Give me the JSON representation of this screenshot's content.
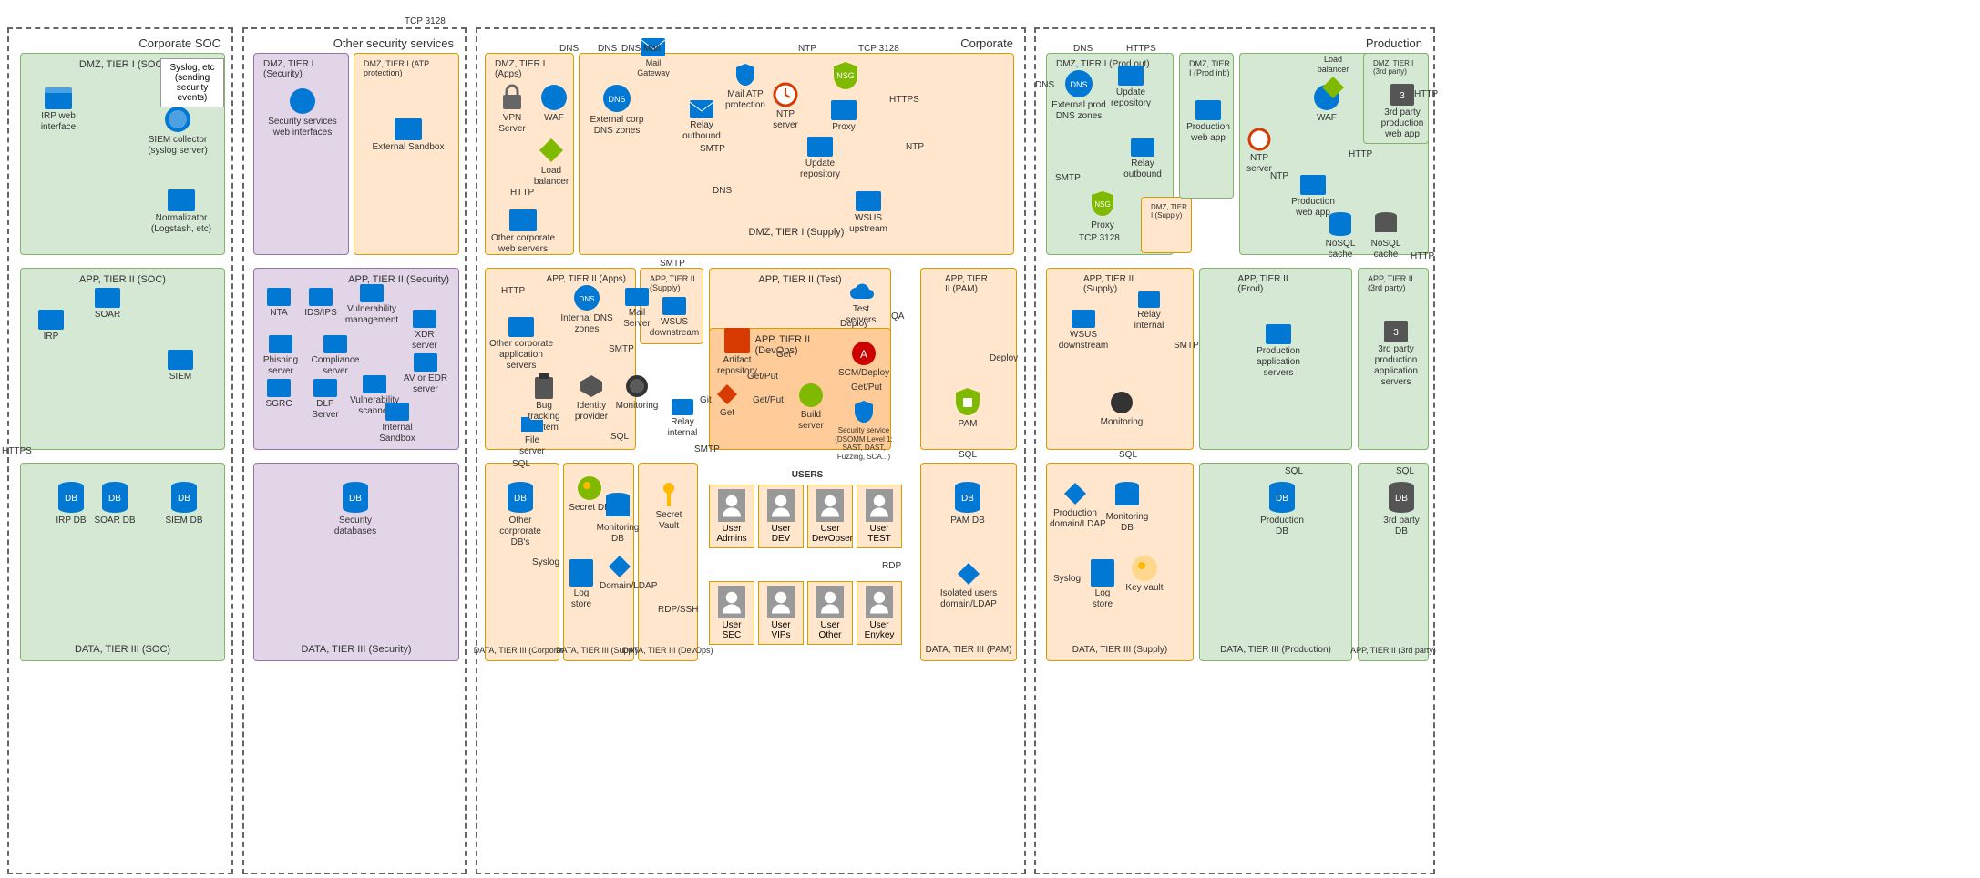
{
  "zones": {
    "soc": "Corporate SOC",
    "security": "Other security services",
    "corporate": "Corporate",
    "production": "Production"
  },
  "tiers": {
    "dmz_soc": "DMZ, TIER I (SOC)",
    "dmz_sec": "DMZ, TIER I (Security)",
    "dmz_atp": "DMZ, TIER I (ATP protection)",
    "dmz_apps": "DMZ, TIER I (Apps)",
    "dmz_supply": "DMZ, TIER I (Supply)",
    "dmz_prod_out": "DMZ, TIER I (Prod out)",
    "dmz_prod_inb": "DMZ, TIER I (Prod inb)",
    "dmz_3rd": "DMZ, TIER I (3rd party)",
    "dmz_supply2": "DMZ, TIER I (Supply)",
    "app_soc": "APP, TIER II (SOC)",
    "app_sec": "APP, TIER II (Security)",
    "app_apps": "APP, TIER II (Apps)",
    "app_supply": "APP, TIER II (Supply)",
    "app_test": "APP, TIER II (Test)",
    "app_devops": "APP, TIER II (DevOps)",
    "app_pam": "APP, TIER II (PAM)",
    "app_supply2": "APP, TIER II (Supply)",
    "app_prod": "APP, TIER II (Prod)",
    "app_3rd": "APP, TIER II (3rd party)",
    "app_3rd_d": "APP, TIER II (3rd party)",
    "data_soc": "DATA, TIER III (SOC)",
    "data_sec": "DATA, TIER III (Security)",
    "data_corp": "DATA, TIER III (Corporate)",
    "data_supply": "DATA, TIER III (Supply)",
    "data_devops": "DATA, TIER III (DevOps)",
    "data_pam": "DATA, TIER III (PAM)",
    "data_supply2": "DATA, TIER III (Supply)",
    "data_prod": "DATA, TIER III (Production)"
  },
  "nodes": {
    "irp_web": "IRP web interface",
    "siem_collector": "SIEM collector (syslog server)",
    "normalizator": "Normalizator (Logstash, etc)",
    "sec_services_web": "Security services web interfaces",
    "ext_sandbox": "External Sandbox",
    "vpn_server": "VPN Server",
    "waf": "WAF",
    "load_balancer": "Load balancer",
    "other_corp_web": "Other corporate web servers",
    "ext_corp_dns": "External corp DNS zones",
    "mail_gateway": "Mail Gateway",
    "relay_outbound": "Relay outbound",
    "mail_atp": "Mail ATP protection",
    "ntp_server": "NTP server",
    "nsg": "NSG",
    "proxy": "Proxy",
    "update_repo": "Update repository",
    "wsus_up": "WSUS upstream",
    "ext_prod_dns": "External prod DNS zones",
    "update_repo2": "Update repository",
    "prod_web_app": "Production web app",
    "prod_web_app2": "Production web app",
    "relay_outbound2": "Relay outbound",
    "nsg2": "NSG",
    "proxy2": "Proxy",
    "waf2": "WAF",
    "load_balancer2": "Load balancer",
    "3rd_web_app": "3rd party production web app",
    "nosql_cache": "NoSQL cache",
    "nosql_cache2": "NoSQL cache",
    "ntp_server2": "NTP server",
    "soar": "SOAR",
    "irp": "IRP",
    "siem": "SIEM",
    "nta": "NTA",
    "ids_ips": "IDS/IPS",
    "vuln_mgmt": "Vulnerability management",
    "xdr_server": "XDR server",
    "phishing": "Phishing server",
    "compliance": "Compliance server",
    "sgrc": "SGRC",
    "dlp_server": "DLP Server",
    "vuln_scanner": "Vulnerability scanner",
    "av_edr": "AV or EDR server",
    "internal_sandbox": "Internal Sandbox",
    "internal_dns": "Internal DNS zones",
    "other_corp_app": "Other corporate application servers",
    "mail_server": "Mail Server",
    "wsus_down": "WSUS downstream",
    "artifact_repo": "Artifact repository",
    "test_servers": "Test servers",
    "bug_tracking": "Bug tracking system",
    "identity_provider": "Identity provider",
    "monitoring": "Monitoring",
    "file_server": "File server",
    "relay_internal": "Relay internal",
    "git": "Git",
    "build_server": "Build server",
    "scm_deploy": "SCM/Deploy",
    "sec_service": "Security service (DSOMM Level 1: SAST, DAST, Fuzzing, SCA...)",
    "pam": "PAM",
    "wsus_down2": "WSUS downstream",
    "relay_internal2": "Relay internal",
    "monitoring2": "Monitoring",
    "prod_app_servers": "Production application servers",
    "3rd_app_servers": "3rd party production application servers",
    "irp_db": "IRP DB",
    "soar_db": "SOAR DB",
    "siem_db": "SIEM DB",
    "sec_db": "Security databases",
    "other_corp_db": "Other corprorate DB's",
    "secret_db": "Secret DB",
    "monitoring_db": "Monitoring DB",
    "secret_vault": "Secret Vault",
    "log_store": "Log store",
    "domain_ldap": "Domain/LDAP",
    "pam_db": "PAM DB",
    "isolated_domain": "Isolated users domain/LDAP",
    "prod_domain": "Production domain/LDAP",
    "monitoring_db2": "Monitoring DB",
    "log_store2": "Log store",
    "key_vault": "Key vault",
    "production_db": "Production DB",
    "3rd_db": "3rd party DB"
  },
  "users": {
    "header": "USERS",
    "admins": "User Admins",
    "dev": "User DEV",
    "devopser": "User DevOpser",
    "test": "User TEST",
    "sec": "User SEC",
    "vips": "User VIPs",
    "other": "User Other",
    "enykey": "User Enykey"
  },
  "labels": {
    "syslog_sending": "Syslog, etc (sending security events)",
    "tcp_3128": "TCP 3128",
    "https": "HTTPS",
    "http": "HTTP",
    "dns": "DNS",
    "mail": "Mail",
    "ntp": "NTP",
    "smtp": "SMTP",
    "sql": "SQL",
    "syslog": "Syslog",
    "rdp": "RDP",
    "rdp_ssh": "RDP/SSH",
    "qa": "QA",
    "deploy": "Deploy",
    "get": "Get",
    "get_put": "Get/Put"
  }
}
